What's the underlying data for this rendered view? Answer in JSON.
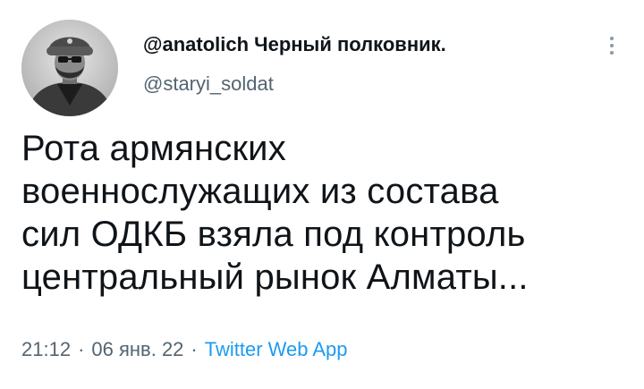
{
  "author": {
    "display_name": "@anatolich Черный полковник.",
    "username": "@staryi_soldat"
  },
  "tweet": {
    "lines": [
      "Рота армянских",
      "военнослужащих из состава",
      "сил ОДКБ взяла под контроль",
      "центральный рынок Алматы..."
    ]
  },
  "meta": {
    "time": "21:12",
    "separator": "·",
    "date": "06 янв. 22",
    "source": "Twitter Web App"
  },
  "icons": {
    "more": "more-vertical-icon",
    "avatar": "avatar"
  },
  "colors": {
    "text": "#0f1419",
    "secondary": "#536471",
    "link": "#1d9bf0"
  }
}
